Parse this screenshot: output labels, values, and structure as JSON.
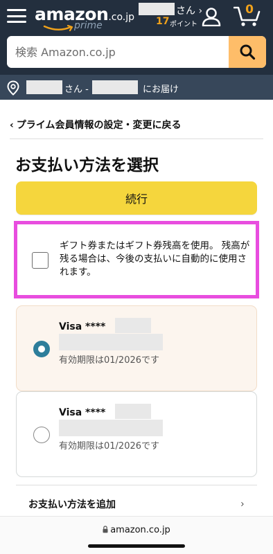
{
  "header": {
    "logo_text": "amazon",
    "logo_domain": ".co.jp",
    "prime_label": "prime",
    "account_suffix": "さん ›",
    "points_value": "17",
    "points_label": "ポイント",
    "cart_count": "0"
  },
  "search": {
    "placeholder": "検索 Amazon.co.jp"
  },
  "delivery": {
    "name_suffix": "さん -",
    "deliver_label": "にお届け"
  },
  "nav": {
    "back_link": "プライム会員情報の設定・変更に戻る"
  },
  "page": {
    "title": "お支払い方法を選択",
    "continue_button": "続行",
    "gift_option_text": "ギフト券またはギフト券残高を使用。 残高が残る場合は、今後の支払いに自動的に使用されます。"
  },
  "payment_methods": [
    {
      "brand": "Visa",
      "masked": "****",
      "expiry": "有効期限は01/2026です",
      "selected": true
    },
    {
      "brand": "Visa",
      "masked": "****",
      "expiry": "有効期限は01/2026です",
      "selected": false
    }
  ],
  "add_payment": {
    "label": "お支払い方法を追加"
  },
  "browser": {
    "url": "amazon.co.jp"
  },
  "colors": {
    "header_bg": "#232f3e",
    "deliver_bg": "#37475a",
    "accent_orange": "#f0a21b",
    "search_button": "#febd69",
    "continue_yellow": "#f5d63d",
    "highlight_magenta": "#e84ddf",
    "radio_selected": "#2d7e9b"
  },
  "icons": [
    "menu-icon",
    "user-icon",
    "cart-icon",
    "search-icon",
    "location-pin-icon",
    "chevron-left-icon",
    "chevron-right-icon",
    "lock-icon"
  ]
}
